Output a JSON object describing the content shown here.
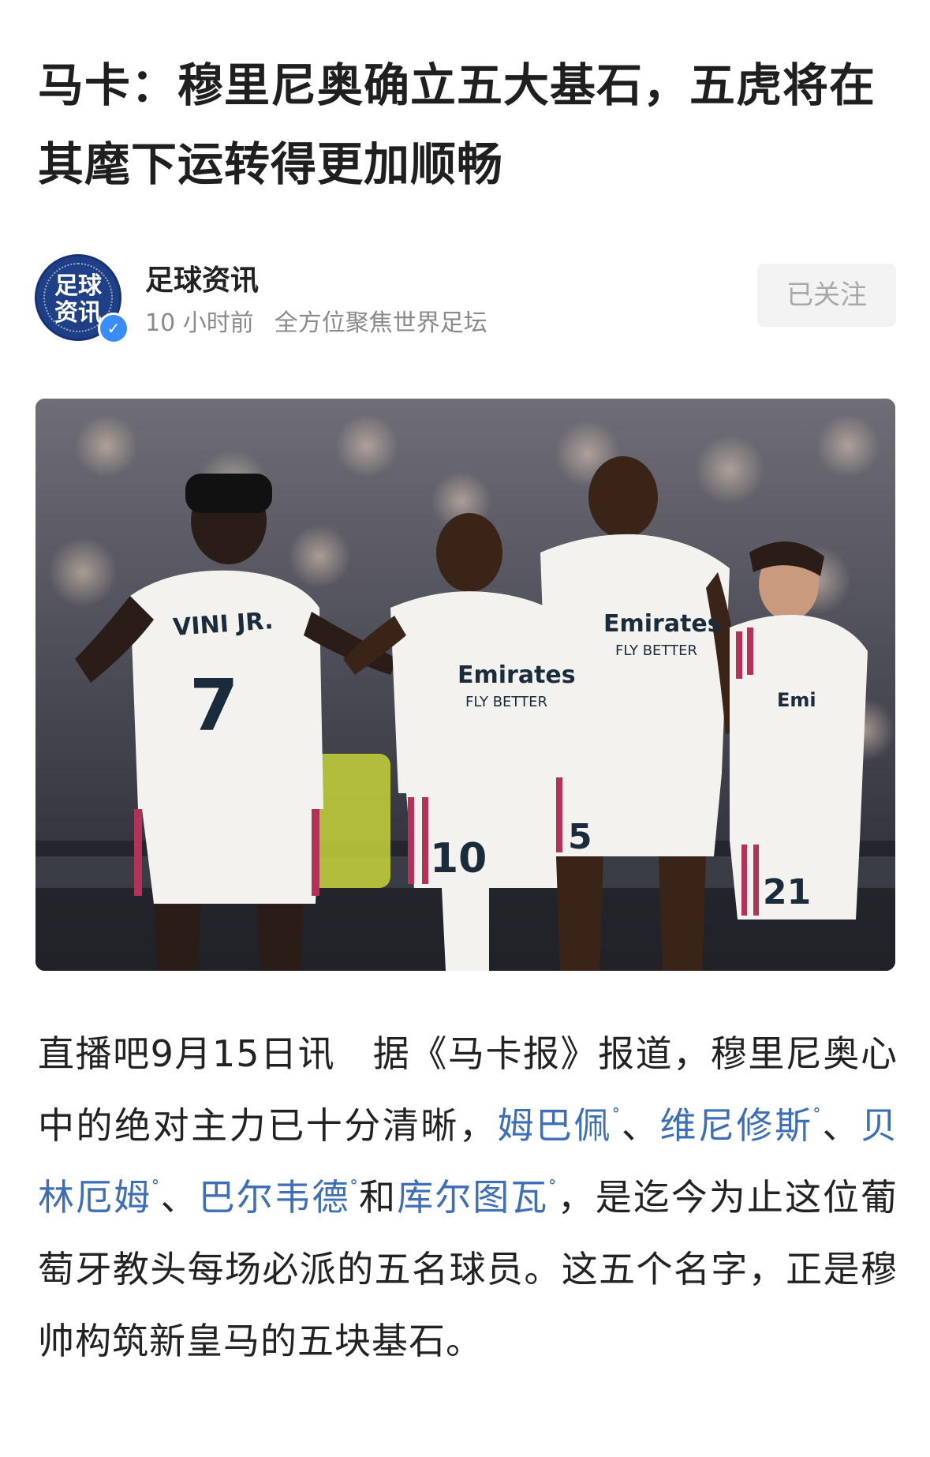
{
  "article": {
    "title": "马卡：穆里尼奥确立五大基石，五虎将在其麾下运转得更加顺畅"
  },
  "author": {
    "name": "足球资讯",
    "avatar_line1": "足球",
    "avatar_line2": "资讯",
    "time": "10 小时前",
    "tagline": "全方位聚焦世界足坛",
    "follow_label": "已关注",
    "verified_icon": "verified-check-icon"
  },
  "photo": {
    "jersey_name": "VINI JR.",
    "numbers": [
      "7",
      "10",
      "5",
      "21"
    ],
    "sponsor": "Emirates",
    "sponsor_sub": "FLY BETTER"
  },
  "body": {
    "p1_a": "直播吧9月15日讯　据《马卡报》报道，穆里尼奥心中的绝对主力已十分清晰，",
    "link1": "姆巴佩",
    "sep1": "、",
    "link2": "维尼修斯",
    "sep2": "、",
    "link3": "贝林厄姆",
    "sep3": "、",
    "link4": "巴尔韦德",
    "and": "和",
    "link5": "库尔图瓦",
    "p1_b": "，是迄今为止这位葡萄牙教头每场必派的五名球员。这五个名字，正是穆帅构筑新皇马的五块基石。",
    "search_icon": "search-icon"
  }
}
